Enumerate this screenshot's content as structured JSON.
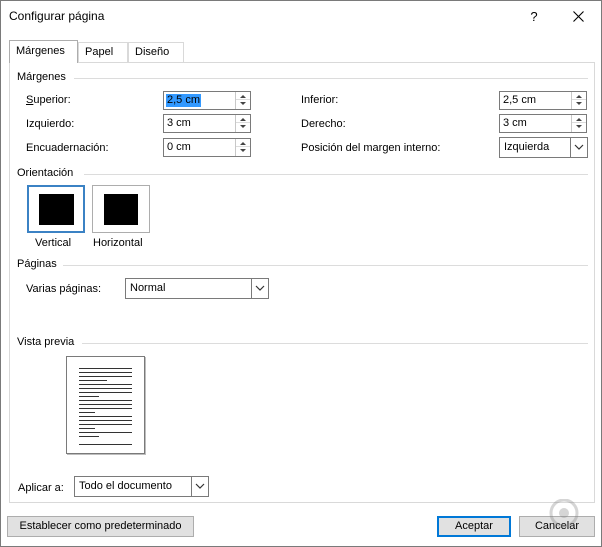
{
  "window": {
    "title": "Configurar página",
    "help": "?"
  },
  "tabs": [
    {
      "label": "Márgenes",
      "active": true
    },
    {
      "label": "Papel",
      "active": false
    },
    {
      "label": "Diseño",
      "active": false
    }
  ],
  "margins": {
    "group_title": "Márgenes",
    "superior": {
      "label": "Superior:",
      "value": "2,5 cm"
    },
    "izquierdo": {
      "label": "Izquierdo:",
      "value": "3 cm"
    },
    "encuadernacion": {
      "label": "Encuadernación:",
      "value": "0 cm"
    },
    "inferior": {
      "label": "Inferior:",
      "value": "2,5 cm"
    },
    "derecho": {
      "label": "Derecho:",
      "value": "3 cm"
    },
    "posicion": {
      "label": "Posición del margen interno:",
      "value": "Izquierda"
    }
  },
  "orientation": {
    "group_title": "Orientación",
    "vertical": "Vertical",
    "horizontal": "Horizontal",
    "selected": "Vertical"
  },
  "pages": {
    "group_title": "Páginas",
    "label": "Varias páginas:",
    "value": "Normal"
  },
  "preview": {
    "group_title": "Vista previa"
  },
  "apply": {
    "label": "Aplicar a:",
    "value": "Todo el documento"
  },
  "buttons": {
    "set_default": "Establecer como predeterminado",
    "accept": "Aceptar",
    "cancel": "Cancelar"
  },
  "colors": {
    "selection": "#3399ff",
    "accent": "#0078d7"
  }
}
